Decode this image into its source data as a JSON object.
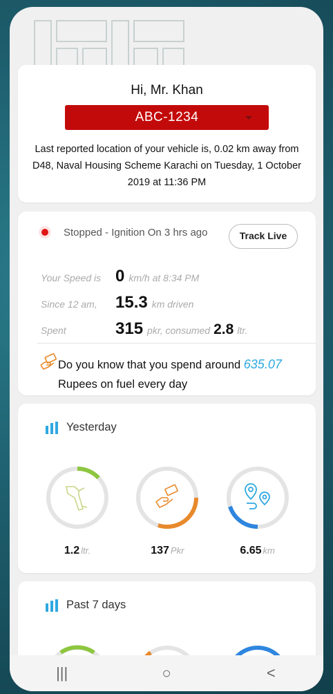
{
  "greeting": "Hi, Mr. Khan",
  "vehicle": {
    "plate": "ABC-1234"
  },
  "location_text": "Last reported location of your vehicle is, 0.02 km away from D48, Naval Housing Scheme Karachi on Tuesday, 1 October 2019 at 11:36 PM",
  "status": {
    "text": "Stopped - Ignition On 3 hrs  ago",
    "color": "#e01515",
    "track_button": "Track Live"
  },
  "stats": {
    "speed_label": "Your Speed is",
    "speed_value": "0",
    "speed_unit": "km/h at 8:34 PM",
    "since_label": "Since 12 am,",
    "distance_value": "15.3",
    "distance_unit": "km  driven",
    "spent_label": "Spent",
    "spent_value": "315",
    "spent_unit": "pkr, consumed",
    "fuel_value": "2.8",
    "fuel_unit": "ltr."
  },
  "tip": {
    "prefix": "Do you know that you spend around",
    "amount": "635.07",
    "suffix": "Rupees on fuel every day",
    "icon": "money-hand-icon"
  },
  "yesterday": {
    "title": "Yesterday",
    "gauges": [
      {
        "icon": "fuel-nozzle-icon",
        "value": "1.2",
        "unit": "ltr.",
        "color": "#8dc63f",
        "fill": 0.13
      },
      {
        "icon": "money-hand-icon",
        "value": "137",
        "unit": "Pkr",
        "color": "#e8892b",
        "fill": 0.3
      },
      {
        "icon": "route-pins-icon",
        "value": "6.65",
        "unit": "km",
        "color": "#2e86de",
        "fill": 0.2
      }
    ]
  },
  "past7": {
    "title": "Past 7 days",
    "gauges": [
      {
        "color": "#8dc63f"
      },
      {
        "color": "#e8892b"
      },
      {
        "color": "#2e86de"
      }
    ]
  },
  "navbar": {
    "recent": "|||",
    "home": "○",
    "back": "<"
  },
  "colors": {
    "accent": "#2ea8e0",
    "plate_bg": "#c30a0a"
  }
}
